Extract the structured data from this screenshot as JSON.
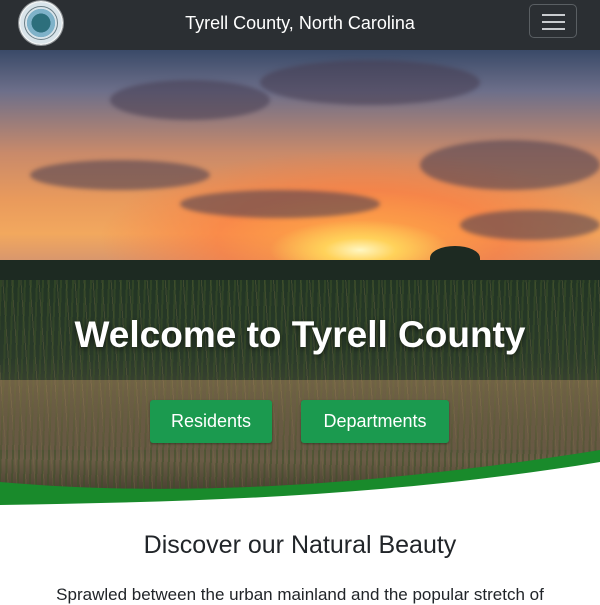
{
  "navbar": {
    "title": "Tyrell County, North Carolina",
    "logo_icon": "county-seal-icon",
    "menu_icon": "hamburger-menu-icon"
  },
  "hero": {
    "title": "Welcome to Tyrell County",
    "buttons": [
      {
        "label": "Residents"
      },
      {
        "label": "Departments"
      }
    ]
  },
  "content": {
    "heading": "Discover our Natural Beauty",
    "intro": "Sprawled between the urban mainland and the popular stretch of"
  },
  "colors": {
    "navbar_bg": "#2b2f33",
    "accent_green": "#1b9a4f",
    "text_dark": "#212529"
  }
}
